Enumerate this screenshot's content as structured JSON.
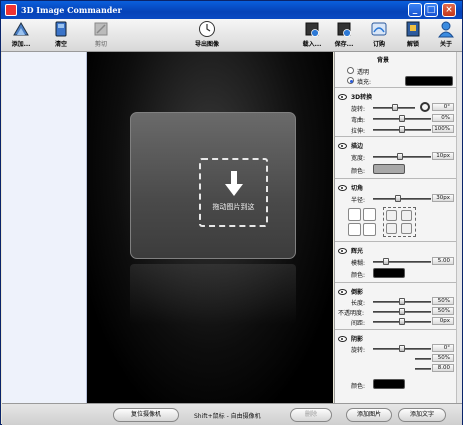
{
  "window": {
    "title": "3D Image Commander"
  },
  "toolbar": {
    "add": "添加...",
    "clear": "清空",
    "cut": "剪切",
    "export": "导出图像",
    "load": "载入...",
    "save": "保存...",
    "subscribe": "订购",
    "unlock": "解锁",
    "about": "关于"
  },
  "canvas": {
    "drop_label": "拖动图片到这"
  },
  "panel": {
    "background": {
      "title": "背景",
      "transparent": "透明",
      "fill": "填充:",
      "fill_color": "#000000",
      "selected": "fill"
    },
    "transform3d": {
      "title": "3D转换",
      "rotate": "旋转:",
      "rotate_value": "0°",
      "bend": "弯曲:",
      "bend_value": "0%",
      "stretch": "拉伸:",
      "stretch_value": "100%"
    },
    "stroke": {
      "title": "描边",
      "width": "宽度:",
      "width_value": "10px",
      "color": "颜色:",
      "color_value": "#a8a8a8"
    },
    "corner": {
      "title": "切角",
      "radius": "半径:",
      "radius_value": "30px"
    },
    "glow": {
      "title": "辉光",
      "blur": "模糊:",
      "blur_value": "5.00",
      "color": "颜色:",
      "color_value": "#000000"
    },
    "reflection": {
      "title": "倒影",
      "length": "长度:",
      "length_value": "50%",
      "opacity": "不透明度:",
      "opacity_value": "50%",
      "gap": "间距:",
      "gap_value": "0px"
    },
    "shadow": {
      "title": "阴影",
      "rotate": "旋转:",
      "rotate_value": "0°",
      "v2": "50%",
      "v3": "8.00",
      "color": "颜色:",
      "color_value": "#000000"
    }
  },
  "statusbar": {
    "reset_camera": "复位摄像机",
    "hint": "Shift+鼠标 - 自由摄像机",
    "delete": "删除",
    "add_image": "添加图片",
    "add_text": "添加文字"
  }
}
